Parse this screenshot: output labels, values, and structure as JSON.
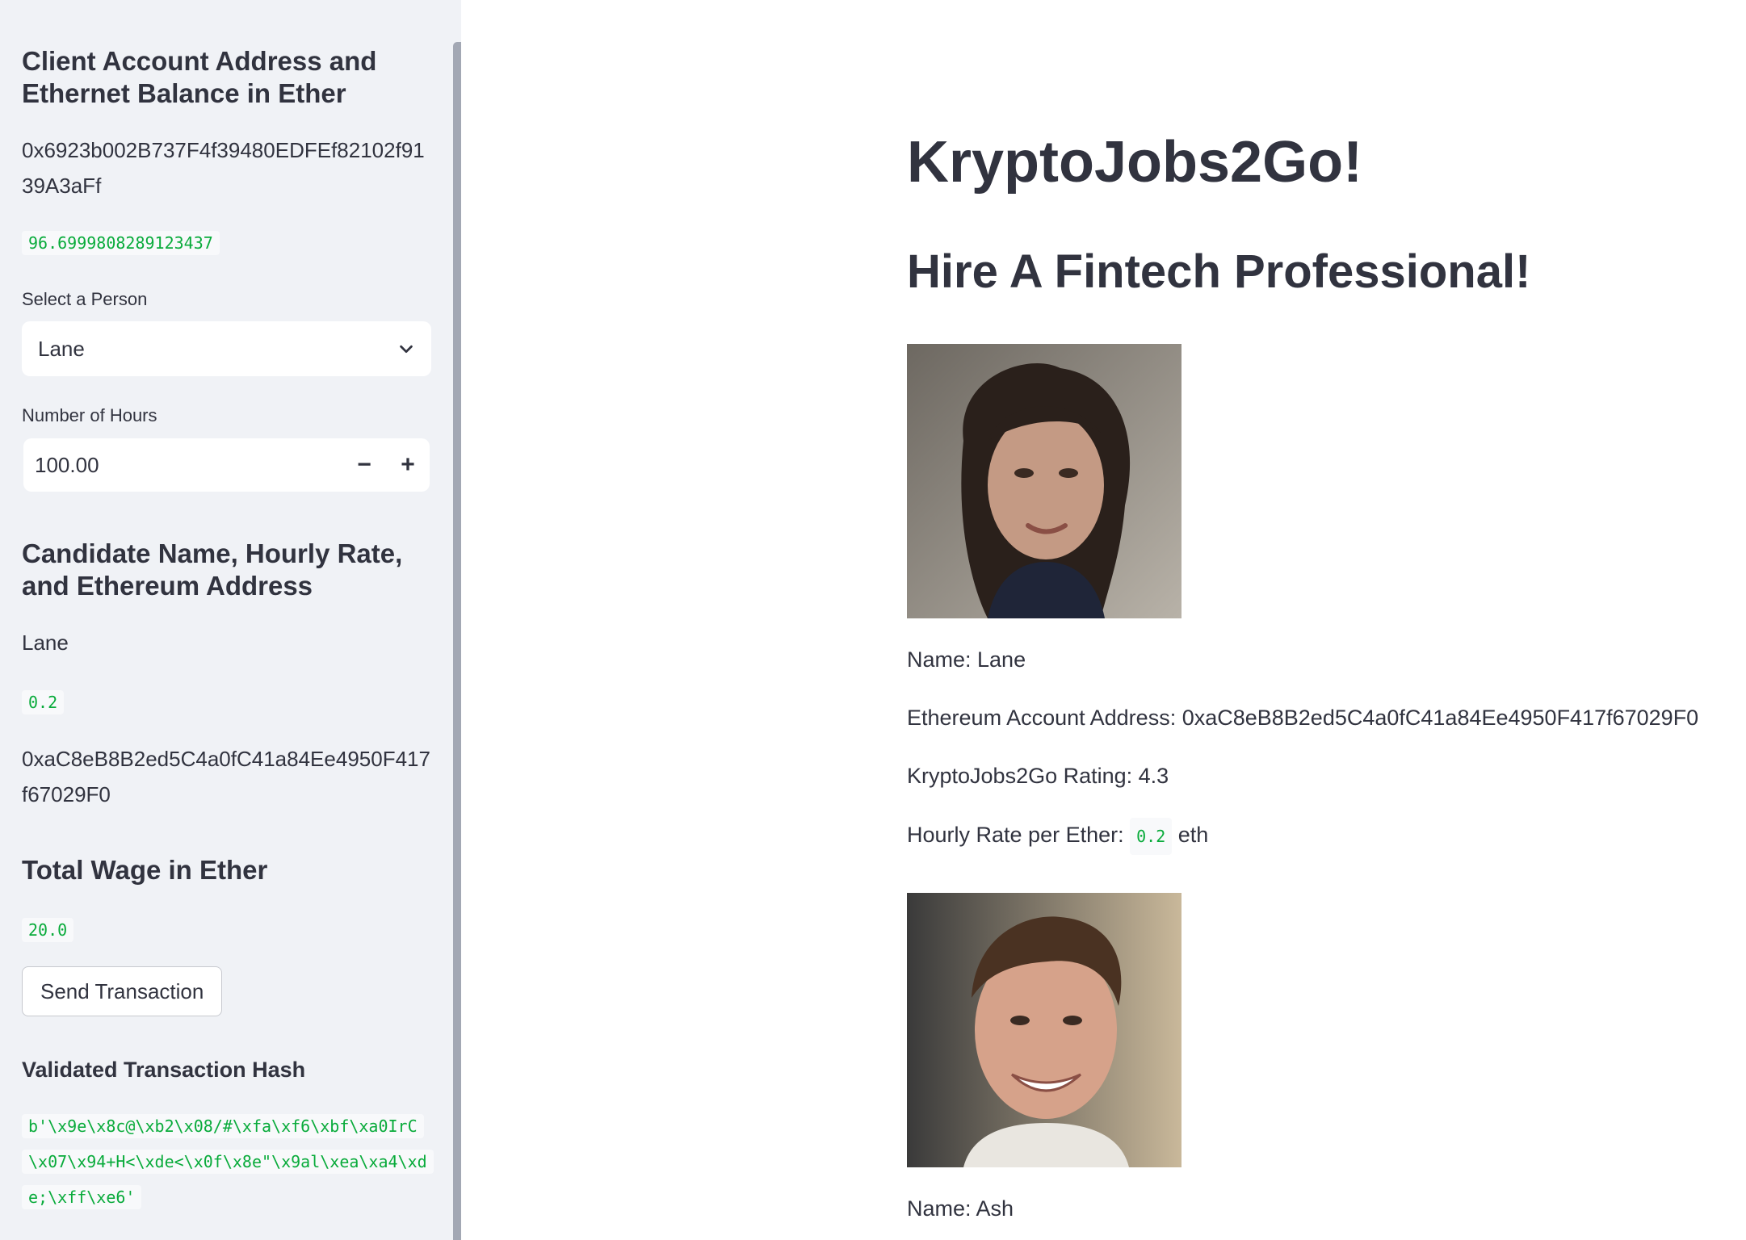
{
  "sidebar": {
    "account_heading": "Client Account Address and Ethernet Balance in Ether",
    "account_address": "0x6923b002B737F4f39480EDFEf82102f9139A3aFf",
    "balance": "96.6999808289123437",
    "select_label": "Select a Person",
    "selected_person": "Lane",
    "hours_label": "Number of Hours",
    "hours_value": "100.00",
    "minus_label": "−",
    "plus_label": "+",
    "candidate_heading": "Candidate Name, Hourly Rate, and Ethereum Address",
    "candidate_name": "Lane",
    "candidate_rate": "0.2",
    "candidate_address": "0xaC8eB8B2ed5C4a0fC41a84Ee4950F417f67029F0",
    "wage_heading": "Total Wage in Ether",
    "wage_value": "20.0",
    "send_button": "Send Transaction",
    "hash_heading": "Validated Transaction Hash",
    "hash_value": "b'\\x9e\\x8c@\\xb2\\x08/#\\xfa\\xf6\\xbf\\xa0IrC\\x07\\x94+H<\\xde<\\x0f\\x8e\"\\x9al\\xea\\xa4\\xde;\\xff\\xe6'"
  },
  "main": {
    "title": "KryptoJobs2Go!",
    "subtitle": "Hire A Fintech Professional!",
    "profiles": [
      {
        "name": "Name: Lane",
        "address": "Ethereum Account Address: 0xaC8eB8B2ed5C4a0fC41a84Ee4950F417f67029F0",
        "rating": "KryptoJobs2Go Rating: 4.3",
        "rate_label": "Hourly Rate per Ether:",
        "rate_value": "0.2",
        "rate_unit": "eth"
      },
      {
        "name": "Name: Ash"
      }
    ]
  },
  "colors": {
    "sidebar_bg": "#f0f2f6",
    "code_green": "#09ab3b",
    "text": "#31333f"
  }
}
